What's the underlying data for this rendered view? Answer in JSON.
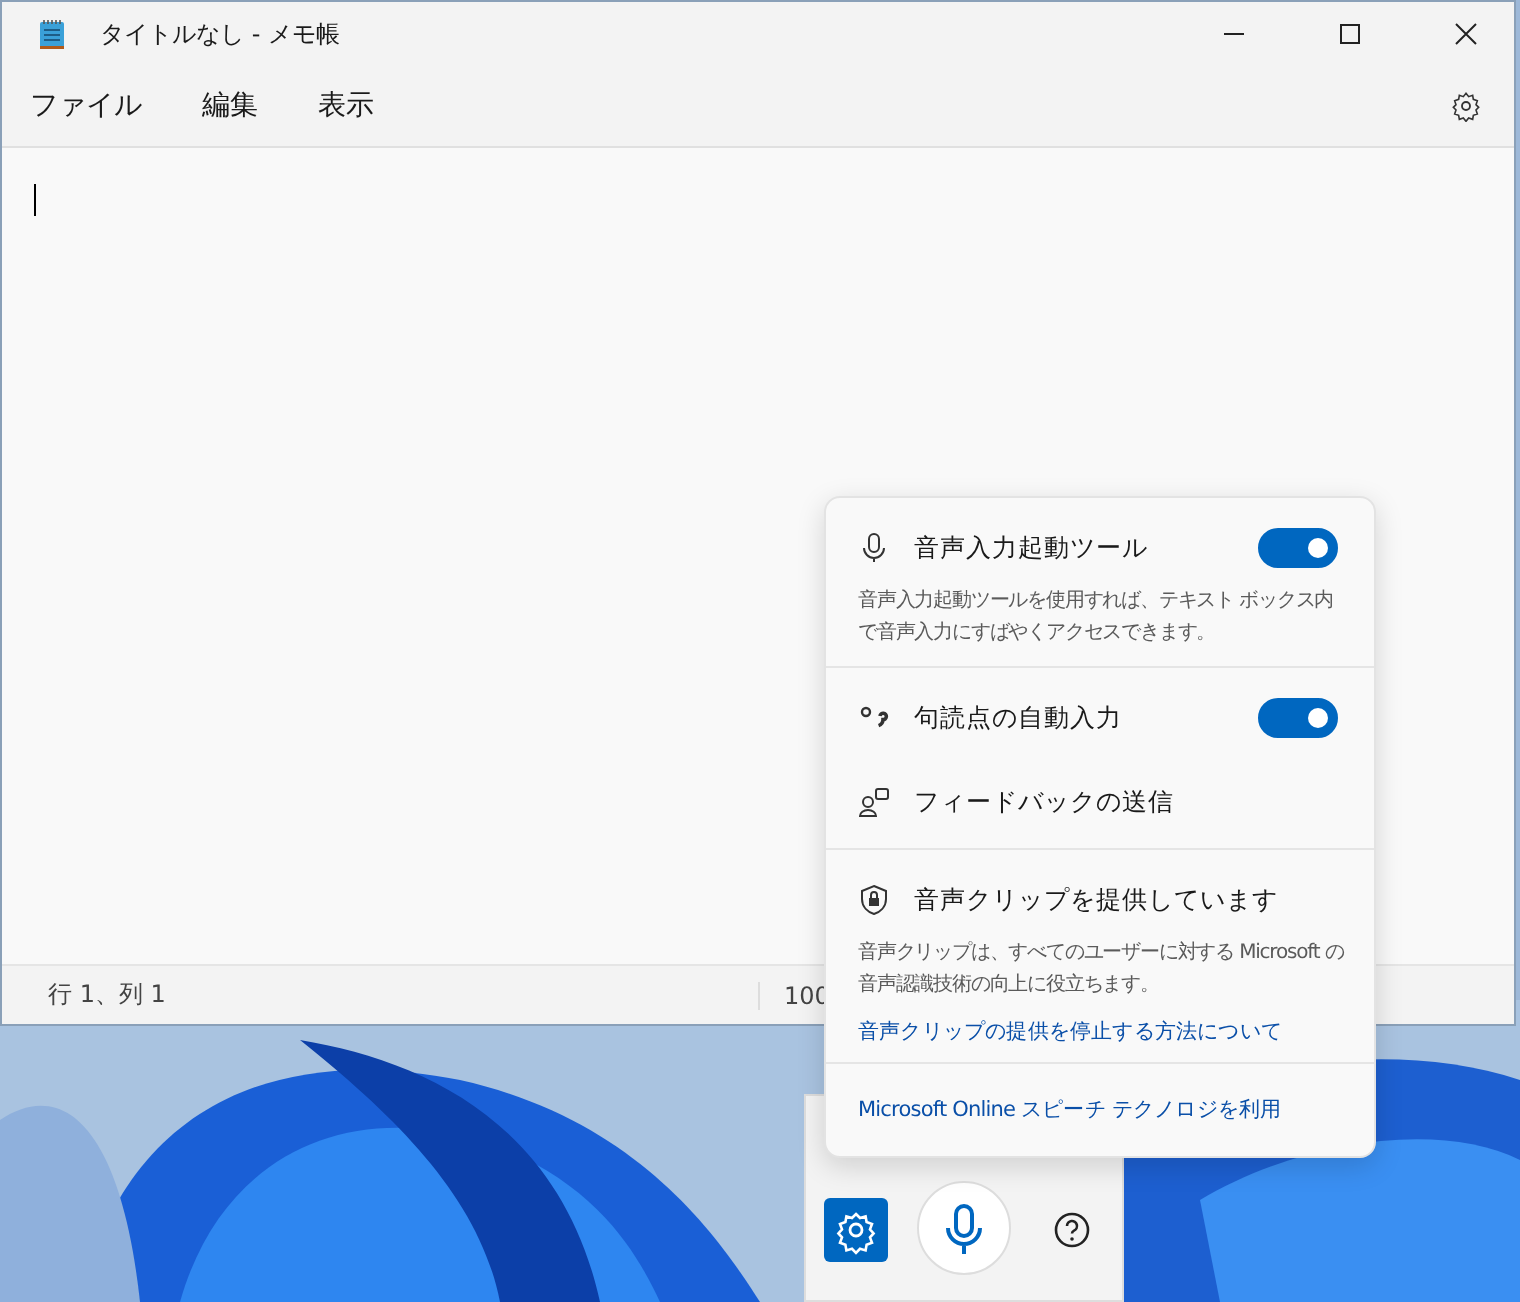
{
  "window": {
    "title": "タイトルなし - メモ帳"
  },
  "menu": [
    {
      "label": "ファイル"
    },
    {
      "label": "編集"
    },
    {
      "label": "表示"
    }
  ],
  "status_bar": {
    "position": "行 1、列 1",
    "zoom": "100"
  },
  "voice_settings": {
    "items": [
      {
        "kind": "toggle",
        "label": "音声入力起動ツール",
        "on": true,
        "description": "音声入力起動ツールを使用すれば、テキスト ボックス内で音声入力にすばやくアクセスできます。"
      },
      {
        "kind": "toggle",
        "label": "句読点の自動入力",
        "on": true
      },
      {
        "kind": "action",
        "label": "フィードバックの送信"
      },
      {
        "kind": "info",
        "label": "音声クリップを提供しています",
        "description": "音声クリップは、すべてのユーザーに対する Microsoft の音声認識技術の向上に役立ちます。",
        "link": "音声クリップの提供を停止する方法について"
      },
      {
        "kind": "link",
        "label": "Microsoft Online スピーチ テクノロジを利用"
      }
    ]
  }
}
